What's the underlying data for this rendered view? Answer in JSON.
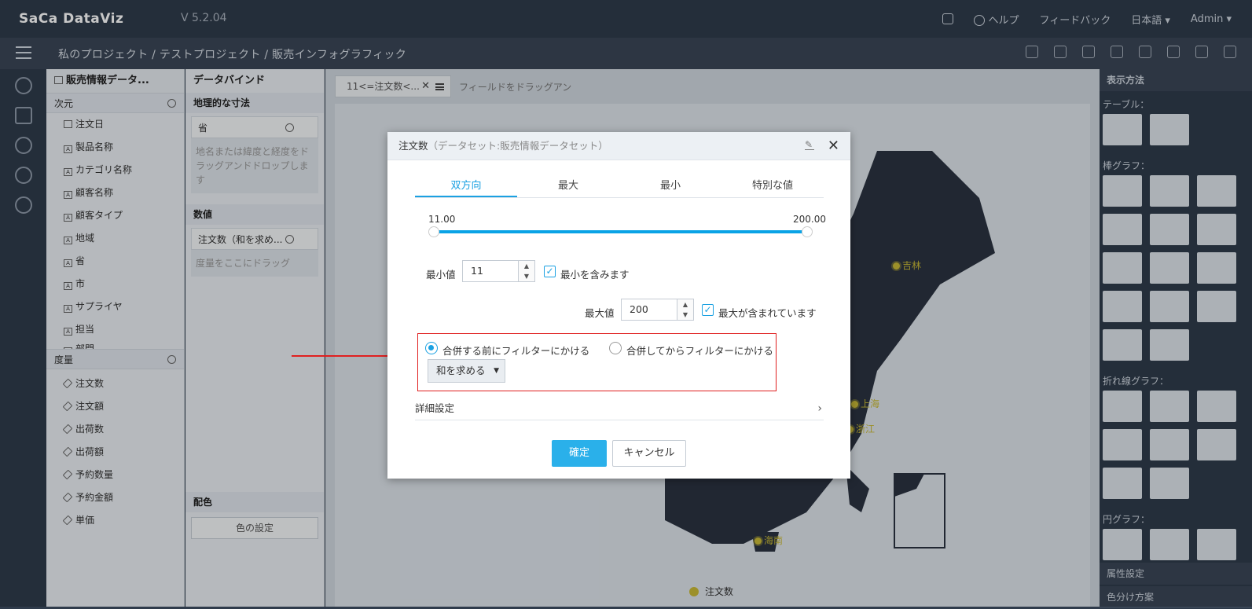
{
  "app": {
    "logo": "SaCa DataViz",
    "version": "V 5.2.04"
  },
  "topnav": {
    "help": "ヘルプ",
    "feedback": "フィードバック",
    "language": "日本語 ▾",
    "user": "Admin ▾"
  },
  "breadcrumb": {
    "path": "私のプロジェクト / テストプロジェクト / 販売インフォグラフィック"
  },
  "dataset_panel": {
    "title": "販売情報データ...",
    "dimensions_label": "次元",
    "dimensions": [
      "注文日",
      "製品名称",
      "カテゴリ名称",
      "顧客名称",
      "顧客タイプ",
      "地域",
      "省",
      "市",
      "サプライヤ",
      "担当",
      "部門"
    ],
    "measures_label": "度量",
    "measures": [
      "注文数",
      "注文額",
      "出荷数",
      "出荷額",
      "予約数量",
      "予約金額",
      "単価"
    ]
  },
  "binding_panel": {
    "title": "データバインド",
    "geo_label": "地理的な寸法",
    "geo_chip": "省",
    "geo_hint": "地名または緯度と経度をドラッグアンドドロップします",
    "value_label": "数値",
    "value_chip": "注文数（和を求め...",
    "value_hint": "度量をここにドラッグ",
    "color_label": "配色",
    "color_button": "色の設定"
  },
  "canvas": {
    "filter_tab": "11<=注文数<...",
    "drop_hint": "フィールドをドラッグアン",
    "cities": [
      "吉林",
      "上海",
      "浙江",
      "海南"
    ],
    "legend": "注文数"
  },
  "right_panel": {
    "title": "表示方法",
    "table_label": "テーブル：",
    "bar_label": "棒グラフ：",
    "line_label": "折れ線グラフ：",
    "pie_label": "円グラフ：",
    "attr_label": "属性設定",
    "color_scheme_label": "色分け方案"
  },
  "dialog": {
    "title": "注文数",
    "subtitle": "（データセット:販売情報データセット）",
    "tabs": [
      "双方向",
      "最大",
      "最小",
      "特別な値"
    ],
    "range_min": "11.00",
    "range_max": "200.00",
    "min_label": "最小値",
    "min_value": "11",
    "min_include": "最小を含みます",
    "max_label": "最大値",
    "max_value": "200",
    "max_include": "最大が含まれています",
    "radio_before": "合併する前にフィルターにかける",
    "radio_after": "合併してからフィルターにかける",
    "aggregate": "和を求める",
    "advanced": "詳細設定",
    "ok": "確定",
    "cancel": "キャンセル"
  },
  "colors": {
    "accent": "#1ba1e2",
    "highlight": "#e02020",
    "map": "#2b3340",
    "marker": "#c8b936"
  }
}
